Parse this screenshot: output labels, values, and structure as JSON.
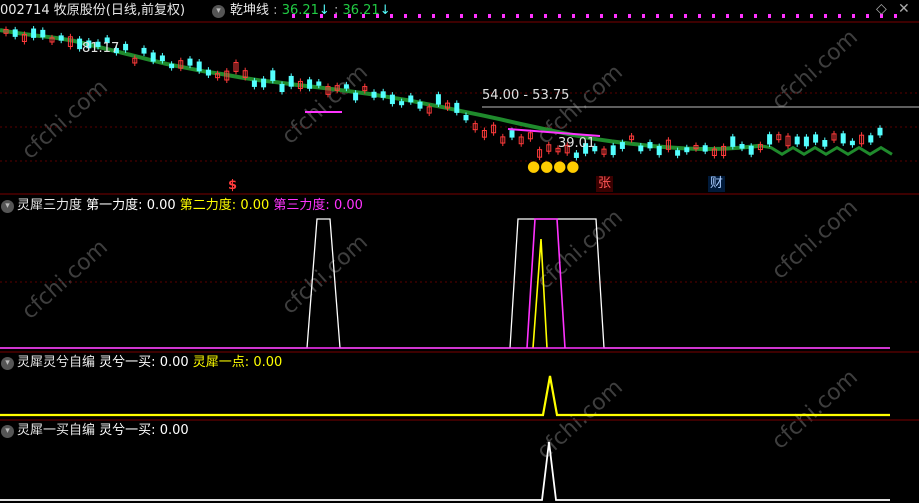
{
  "header": {
    "code": "002714",
    "name": "牧原股份",
    "mode": "(日线,前复权)",
    "indicator": "乾坤线",
    "sep": ":",
    "value1": "36.21",
    "value2": "36.21",
    "arrow": "↓"
  },
  "colors": {
    "bg": "#000000",
    "up": "#ff3b3b",
    "down": "#54ffff",
    "ma": "#1f8a2c",
    "white": "#ffffff",
    "yellow": "#ffff00",
    "magenta": "#ff33ff",
    "panel_border": "#7a0000",
    "grid": "#5a0000",
    "watermark": "#3e3e3e"
  },
  "price_panel": {
    "label_high": "81.17",
    "label_range": "54.00 - 53.75",
    "label_low": "39.01",
    "markers": [
      {
        "text": "$",
        "color": "#ff3b3b",
        "kind": "plain"
      },
      {
        "text": "张",
        "color": "#ff5555",
        "kind": "box"
      },
      {
        "text": "财",
        "color": "#aaccff",
        "kind": "box"
      }
    ]
  },
  "panel2": {
    "title": "灵犀三力度",
    "items": [
      {
        "label": "第一力度",
        "value": "0.00",
        "color": "#ffffff"
      },
      {
        "label": "第二力度",
        "value": "0.00",
        "color": "#ffff00"
      },
      {
        "label": "第三力度",
        "value": "0.00",
        "color": "#ff33ff"
      }
    ]
  },
  "panel3": {
    "title": "灵犀灵兮自编",
    "items": [
      {
        "label": "灵兮一买",
        "value": "0.00",
        "color": "#ffffff"
      },
      {
        "label": "灵犀一点",
        "value": "0.00",
        "color": "#ffff00"
      }
    ]
  },
  "panel4": {
    "title": "灵犀一买自编",
    "items": [
      {
        "label": "灵兮一买",
        "value": "0.00",
        "color": "#ffffff"
      }
    ]
  },
  "watermark": "cfchi.com",
  "chart_data": {
    "type": "line",
    "title": "002714 牧原股份 (日线,前复权)",
    "price": {
      "labels": {
        "high": 81.17,
        "range_hi": 54.0,
        "range_lo": 53.75,
        "low": 39.01
      },
      "ylim": [
        32,
        86
      ],
      "ma_series": [
        84,
        83,
        82.2,
        81.5,
        80.5,
        79,
        77.5,
        76,
        74.5,
        73,
        71.8,
        70.6,
        69.7,
        68.6,
        67.7,
        67,
        66.2,
        65.5,
        64.8,
        64,
        63.2,
        62.2,
        61.2,
        60,
        58.8,
        57.5,
        56.3,
        55,
        53.6,
        52.3,
        51,
        49.8,
        48.7,
        47.8,
        47.1,
        46.4,
        45.9,
        45.5,
        45.3,
        45.4,
        45.8,
        46.4
      ]
    },
    "indicators": [
      {
        "panel": "灵犀三力度",
        "series": [
          {
            "name": "第一力度",
            "values": [
              0,
              1,
              1,
              0,
              0,
              1,
              1,
              1,
              0
            ]
          },
          {
            "name": "第二力度",
            "values": [
              0,
              0,
              1,
              0
            ]
          },
          {
            "name": "第三力度",
            "values": [
              0,
              0,
              1,
              1,
              0
            ]
          }
        ]
      },
      {
        "panel": "灵犀灵兮自编",
        "series": [
          {
            "name": "灵兮一买",
            "values": [
              0,
              0
            ]
          },
          {
            "name": "灵犀一点",
            "values": [
              0,
              1,
              0
            ]
          }
        ]
      },
      {
        "panel": "灵犀一买自编",
        "series": [
          {
            "name": "灵兮一买",
            "values": [
              0,
              1,
              0
            ]
          }
        ]
      }
    ]
  }
}
